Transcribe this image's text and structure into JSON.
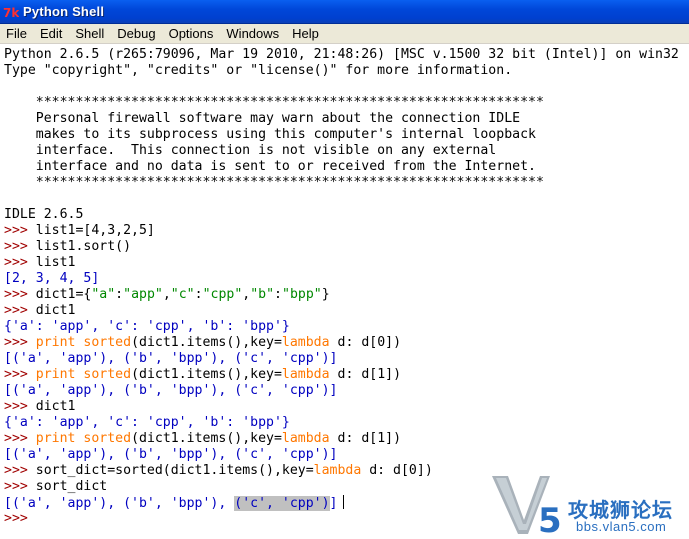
{
  "window": {
    "title": "Python Shell",
    "icon": "python-idle-icon"
  },
  "menu": [
    "File",
    "Edit",
    "Shell",
    "Debug",
    "Options",
    "Windows",
    "Help"
  ],
  "shell_lines": [
    [
      {
        "t": "Python 2.6.5 (r265:79096, Mar 19 2010, 21:48:26) [MSC v.1500 32 bit (Intel)] on win32",
        "c": "out"
      }
    ],
    [
      {
        "t": "Type \"copyright\", \"credits\" or \"license()\" for more information.",
        "c": "out"
      }
    ],
    [],
    [
      {
        "t": "    ****************************************************************",
        "c": "out"
      }
    ],
    [
      {
        "t": "    Personal firewall software may warn about the connection IDLE",
        "c": "out"
      }
    ],
    [
      {
        "t": "    makes to its subprocess using this computer's internal loopback",
        "c": "out"
      }
    ],
    [
      {
        "t": "    interface.  This connection is not visible on any external",
        "c": "out"
      }
    ],
    [
      {
        "t": "    interface and no data is sent to or received from the Internet.",
        "c": "out"
      }
    ],
    [
      {
        "t": "    ****************************************************************",
        "c": "out"
      }
    ],
    [],
    [
      {
        "t": "IDLE 2.6.5",
        "c": "out"
      }
    ],
    [
      {
        "t": ">>> ",
        "c": "prompt"
      },
      {
        "t": "list1=[4,3,2,5]",
        "c": "code"
      }
    ],
    [
      {
        "t": ">>> ",
        "c": "prompt"
      },
      {
        "t": "list1.sort()",
        "c": "code"
      }
    ],
    [
      {
        "t": ">>> ",
        "c": "prompt"
      },
      {
        "t": "list1",
        "c": "code"
      }
    ],
    [
      {
        "t": "[2, 3, 4, 5]",
        "c": "res"
      }
    ],
    [
      {
        "t": ">>> ",
        "c": "prompt"
      },
      {
        "t": "dict1={",
        "c": "code"
      },
      {
        "t": "\"a\"",
        "c": "str"
      },
      {
        "t": ":",
        "c": "code"
      },
      {
        "t": "\"app\"",
        "c": "str"
      },
      {
        "t": ",",
        "c": "code"
      },
      {
        "t": "\"c\"",
        "c": "str"
      },
      {
        "t": ":",
        "c": "code"
      },
      {
        "t": "\"cpp\"",
        "c": "str"
      },
      {
        "t": ",",
        "c": "code"
      },
      {
        "t": "\"b\"",
        "c": "str"
      },
      {
        "t": ":",
        "c": "code"
      },
      {
        "t": "\"bpp\"",
        "c": "str"
      },
      {
        "t": "}",
        "c": "code"
      }
    ],
    [
      {
        "t": ">>> ",
        "c": "prompt"
      },
      {
        "t": "dict1",
        "c": "code"
      }
    ],
    [
      {
        "t": "{'a': 'app', 'c': 'cpp', 'b': 'bpp'}",
        "c": "res"
      }
    ],
    [
      {
        "t": ">>> ",
        "c": "prompt"
      },
      {
        "t": "print",
        "c": "kw"
      },
      {
        "t": " ",
        "c": "code"
      },
      {
        "t": "sorted",
        "c": "kw"
      },
      {
        "t": "(dict1.items(),key=",
        "c": "code"
      },
      {
        "t": "lambda",
        "c": "kw"
      },
      {
        "t": " d: d[0])",
        "c": "code"
      }
    ],
    [
      {
        "t": "[('a', 'app'), ('b', 'bpp'), ('c', 'cpp')]",
        "c": "res"
      }
    ],
    [
      {
        "t": ">>> ",
        "c": "prompt"
      },
      {
        "t": "print",
        "c": "kw"
      },
      {
        "t": " ",
        "c": "code"
      },
      {
        "t": "sorted",
        "c": "kw"
      },
      {
        "t": "(dict1.items(),key=",
        "c": "code"
      },
      {
        "t": "lambda",
        "c": "kw"
      },
      {
        "t": " d: d[1])",
        "c": "code"
      }
    ],
    [
      {
        "t": "[('a', 'app'), ('b', 'bpp'), ('c', 'cpp')]",
        "c": "res"
      }
    ],
    [
      {
        "t": ">>> ",
        "c": "prompt"
      },
      {
        "t": "dict1",
        "c": "code"
      }
    ],
    [
      {
        "t": "{'a': 'app', 'c': 'cpp', 'b': 'bpp'}",
        "c": "res"
      }
    ],
    [
      {
        "t": ">>> ",
        "c": "prompt"
      },
      {
        "t": "print",
        "c": "kw"
      },
      {
        "t": " ",
        "c": "code"
      },
      {
        "t": "sorted",
        "c": "kw"
      },
      {
        "t": "(dict1.items(),key=",
        "c": "code"
      },
      {
        "t": "lambda",
        "c": "kw"
      },
      {
        "t": " d: d[1])",
        "c": "code"
      }
    ],
    [
      {
        "t": "[('a', 'app'), ('b', 'bpp'), ('c', 'cpp')]",
        "c": "res"
      }
    ],
    [
      {
        "t": ">>> ",
        "c": "prompt"
      },
      {
        "t": "sort_dict=sorted(dict1.items(),key=",
        "c": "code"
      },
      {
        "t": "lambda",
        "c": "kw"
      },
      {
        "t": " d: d[0])",
        "c": "code"
      }
    ],
    [
      {
        "t": ">>> ",
        "c": "prompt"
      },
      {
        "t": "sort_dict",
        "c": "code"
      }
    ],
    [
      {
        "t": "[('a', 'app'), ('b', 'bpp'), ",
        "c": "res"
      },
      {
        "t": "('c', 'cpp')",
        "c": "res",
        "sel": true
      },
      {
        "t": "]",
        "c": "res"
      },
      {
        "t": "",
        "c": "cursor"
      }
    ],
    [
      {
        "t": ">>> ",
        "c": "prompt"
      }
    ]
  ],
  "colors": {
    "prompt": "#a00000",
    "string": "#008800",
    "keyword": "#ff7700",
    "result": "#0000c0",
    "selection": "#c0c0c0",
    "titlebar": "#0047d9"
  },
  "watermark": {
    "logo": "v5-logo-icon",
    "text": "攻城狮论坛",
    "url": "bbs.vlan5.com"
  }
}
